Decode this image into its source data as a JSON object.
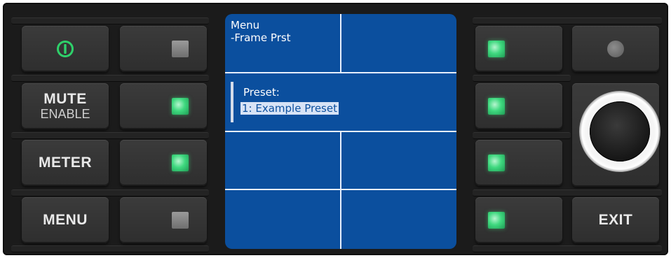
{
  "left_buttons": [
    {
      "id": "power",
      "icon": "power-icon",
      "color": "#2ed16a"
    },
    {
      "id": "mute",
      "label": "MUTE",
      "sub": "ENABLE"
    },
    {
      "id": "meter",
      "label": "METER"
    },
    {
      "id": "menu",
      "label": "MENU"
    }
  ],
  "left_indicators": [
    "off",
    "green",
    "green",
    "off"
  ],
  "screen": {
    "title": "Menu",
    "subtitle": "-Frame Prst",
    "field_label": "Preset:",
    "field_value": "1: Example Preset",
    "background": "#0b4f9e"
  },
  "right_indicators": [
    "green",
    "green",
    "green",
    "green"
  ],
  "right_buttons": {
    "top_led": "off",
    "knob": "encoder-knob",
    "exit_label": "EXIT"
  },
  "colors": {
    "led_green": "#3fd97f",
    "panel": "#1b1b1b",
    "button": "#333333"
  }
}
